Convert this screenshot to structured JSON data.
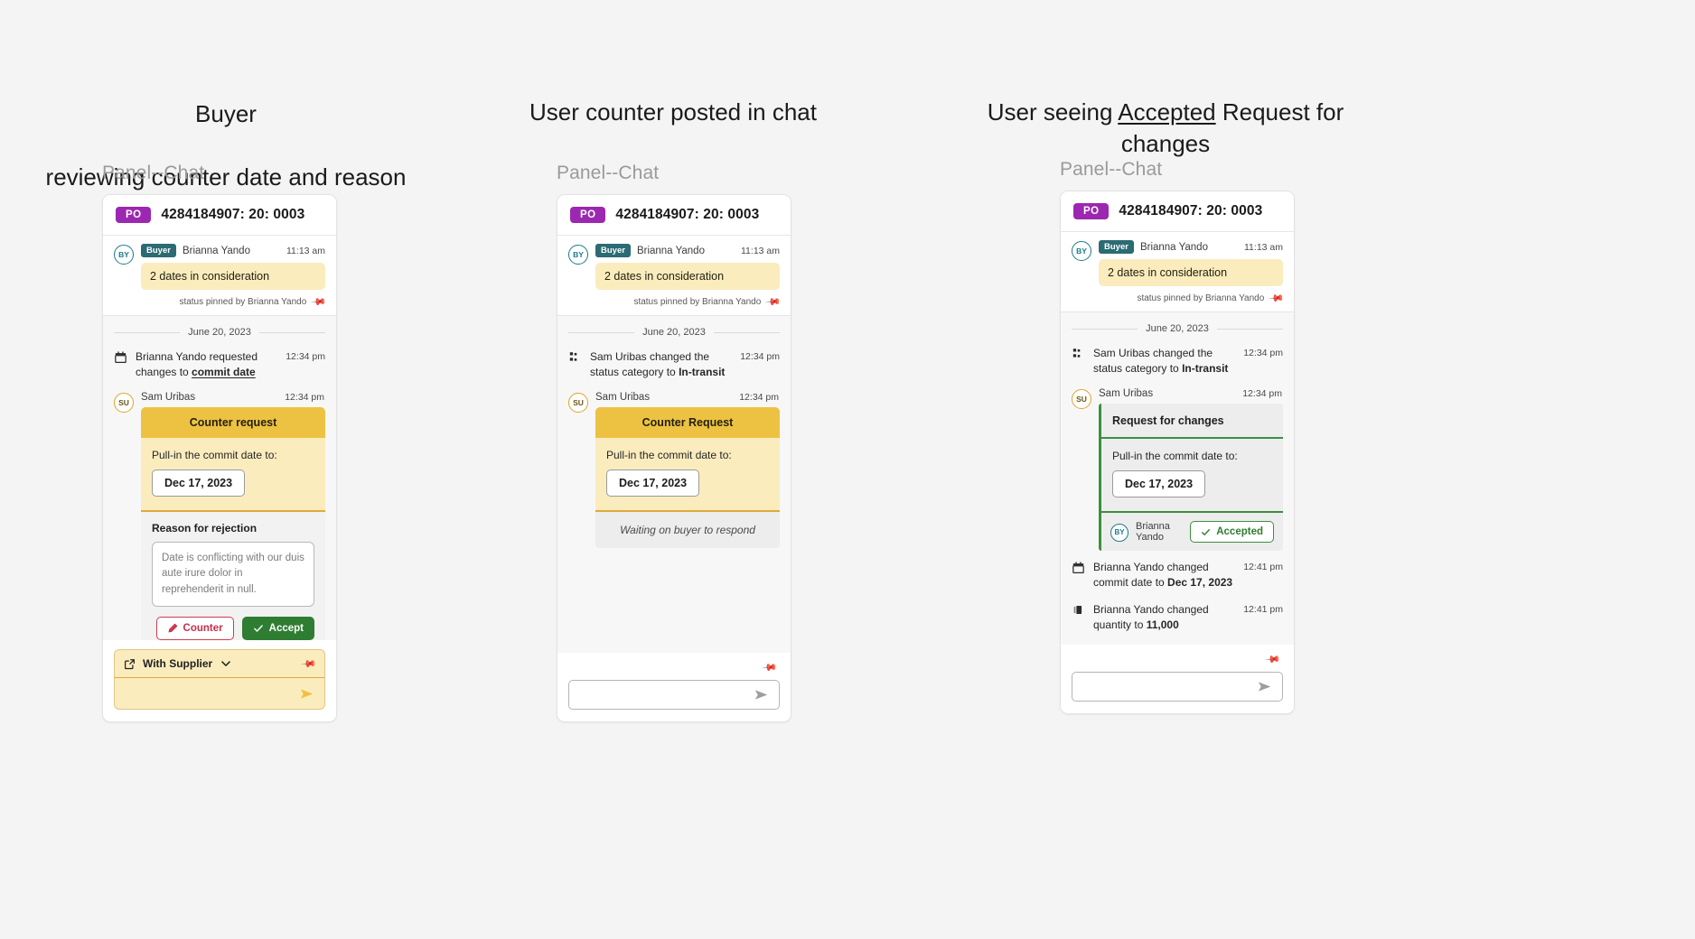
{
  "columns": [
    {
      "heading_line1": "Buyer",
      "heading_line2": "reviewing counter date and reason"
    },
    {
      "heading_line1": "User counter posted in chat",
      "heading_line2": ""
    },
    {
      "heading_pre": "User seeing ",
      "heading_underlined": "Accepted",
      "heading_post": " Request for changes"
    }
  ],
  "panel_label": "Panel--Chat",
  "header": {
    "badge": "PO",
    "number": "4284184907: 20: 0003",
    "badge_color": "#9c27b0"
  },
  "pinned": {
    "avatar": "BY",
    "role": "Buyer",
    "name": "Brianna Yando",
    "time": "11:13 am",
    "message": "2 dates in consideration",
    "pinned_note": "status pinned by Brianna Yando",
    "pin_icon": "pin-icon"
  },
  "day_separator": "June 20, 2023",
  "panel1": {
    "activity": {
      "icon": "calendar-icon",
      "text_before": "Brianna Yando requested changes to ",
      "text_link": "commit date",
      "time": "12:34 pm"
    },
    "card": {
      "avatar": "SU",
      "author": "Sam Uribas",
      "time": "12:34 pm",
      "title": "Counter request",
      "date_label": "Pull-in the commit date to:",
      "date_value": "Dec 17, 2023",
      "reason_title": "Reason for rejection",
      "reason_text": "Date is conflicting with our duis aute irure dolor in reprehenderit in null.",
      "btn_counter": "Counter",
      "btn_counter_icon": "pencil-icon",
      "btn_accept": "Accept",
      "btn_accept_icon": "check-icon"
    },
    "composer": {
      "scope": "With Supplier",
      "scope_icon": "external-link-icon",
      "chevron_icon": "chevron-down-icon",
      "pin_icon": "pin-icon",
      "send_icon": "send-icon",
      "send_color": "#f0c040"
    }
  },
  "panel2": {
    "activity": {
      "icon": "status-category-icon",
      "text_before": "Sam Uribas changed the status category to ",
      "text_bold": "In-transit",
      "time": "12:34 pm"
    },
    "card": {
      "avatar": "SU",
      "author": "Sam Uribas",
      "time": "12:34 pm",
      "title": "Counter Request",
      "date_label": "Pull-in the commit date to:",
      "date_value": "Dec 17, 2023",
      "footer_note": "Waiting on buyer to respond"
    },
    "composer": {
      "pin_icon": "pin-icon",
      "send_icon": "send-icon",
      "send_color": "#9e9e9e"
    }
  },
  "panel3": {
    "activity": {
      "icon": "status-category-icon",
      "text_before": "Sam Uribas changed the status category to ",
      "text_bold": "In-transit",
      "time": "12:34 pm"
    },
    "card": {
      "avatar": "SU",
      "author": "Sam Uribas",
      "time": "12:34 pm",
      "title": "Request for changes",
      "date_label": "Pull-in the commit date to:",
      "date_value": "Dec 17, 2023",
      "approver_avatar": "BY",
      "approver_name": "Brianna Yando",
      "accepted_label": "Accepted",
      "accepted_icon": "check-icon",
      "accent_color": "#3c8f3f"
    },
    "activity2": {
      "icon": "calendar-icon",
      "text_before": "Brianna Yando changed commit date to ",
      "text_bold": "Dec 17, 2023",
      "time": "12:41 pm"
    },
    "activity3": {
      "icon": "quantity-icon",
      "text_before": "Brianna Yando changed quantity to ",
      "text_bold": "11,000",
      "time": "12:41 pm"
    },
    "composer": {
      "pin_icon": "pin-icon",
      "send_icon": "send-icon",
      "send_color": "#9e9e9e"
    }
  }
}
